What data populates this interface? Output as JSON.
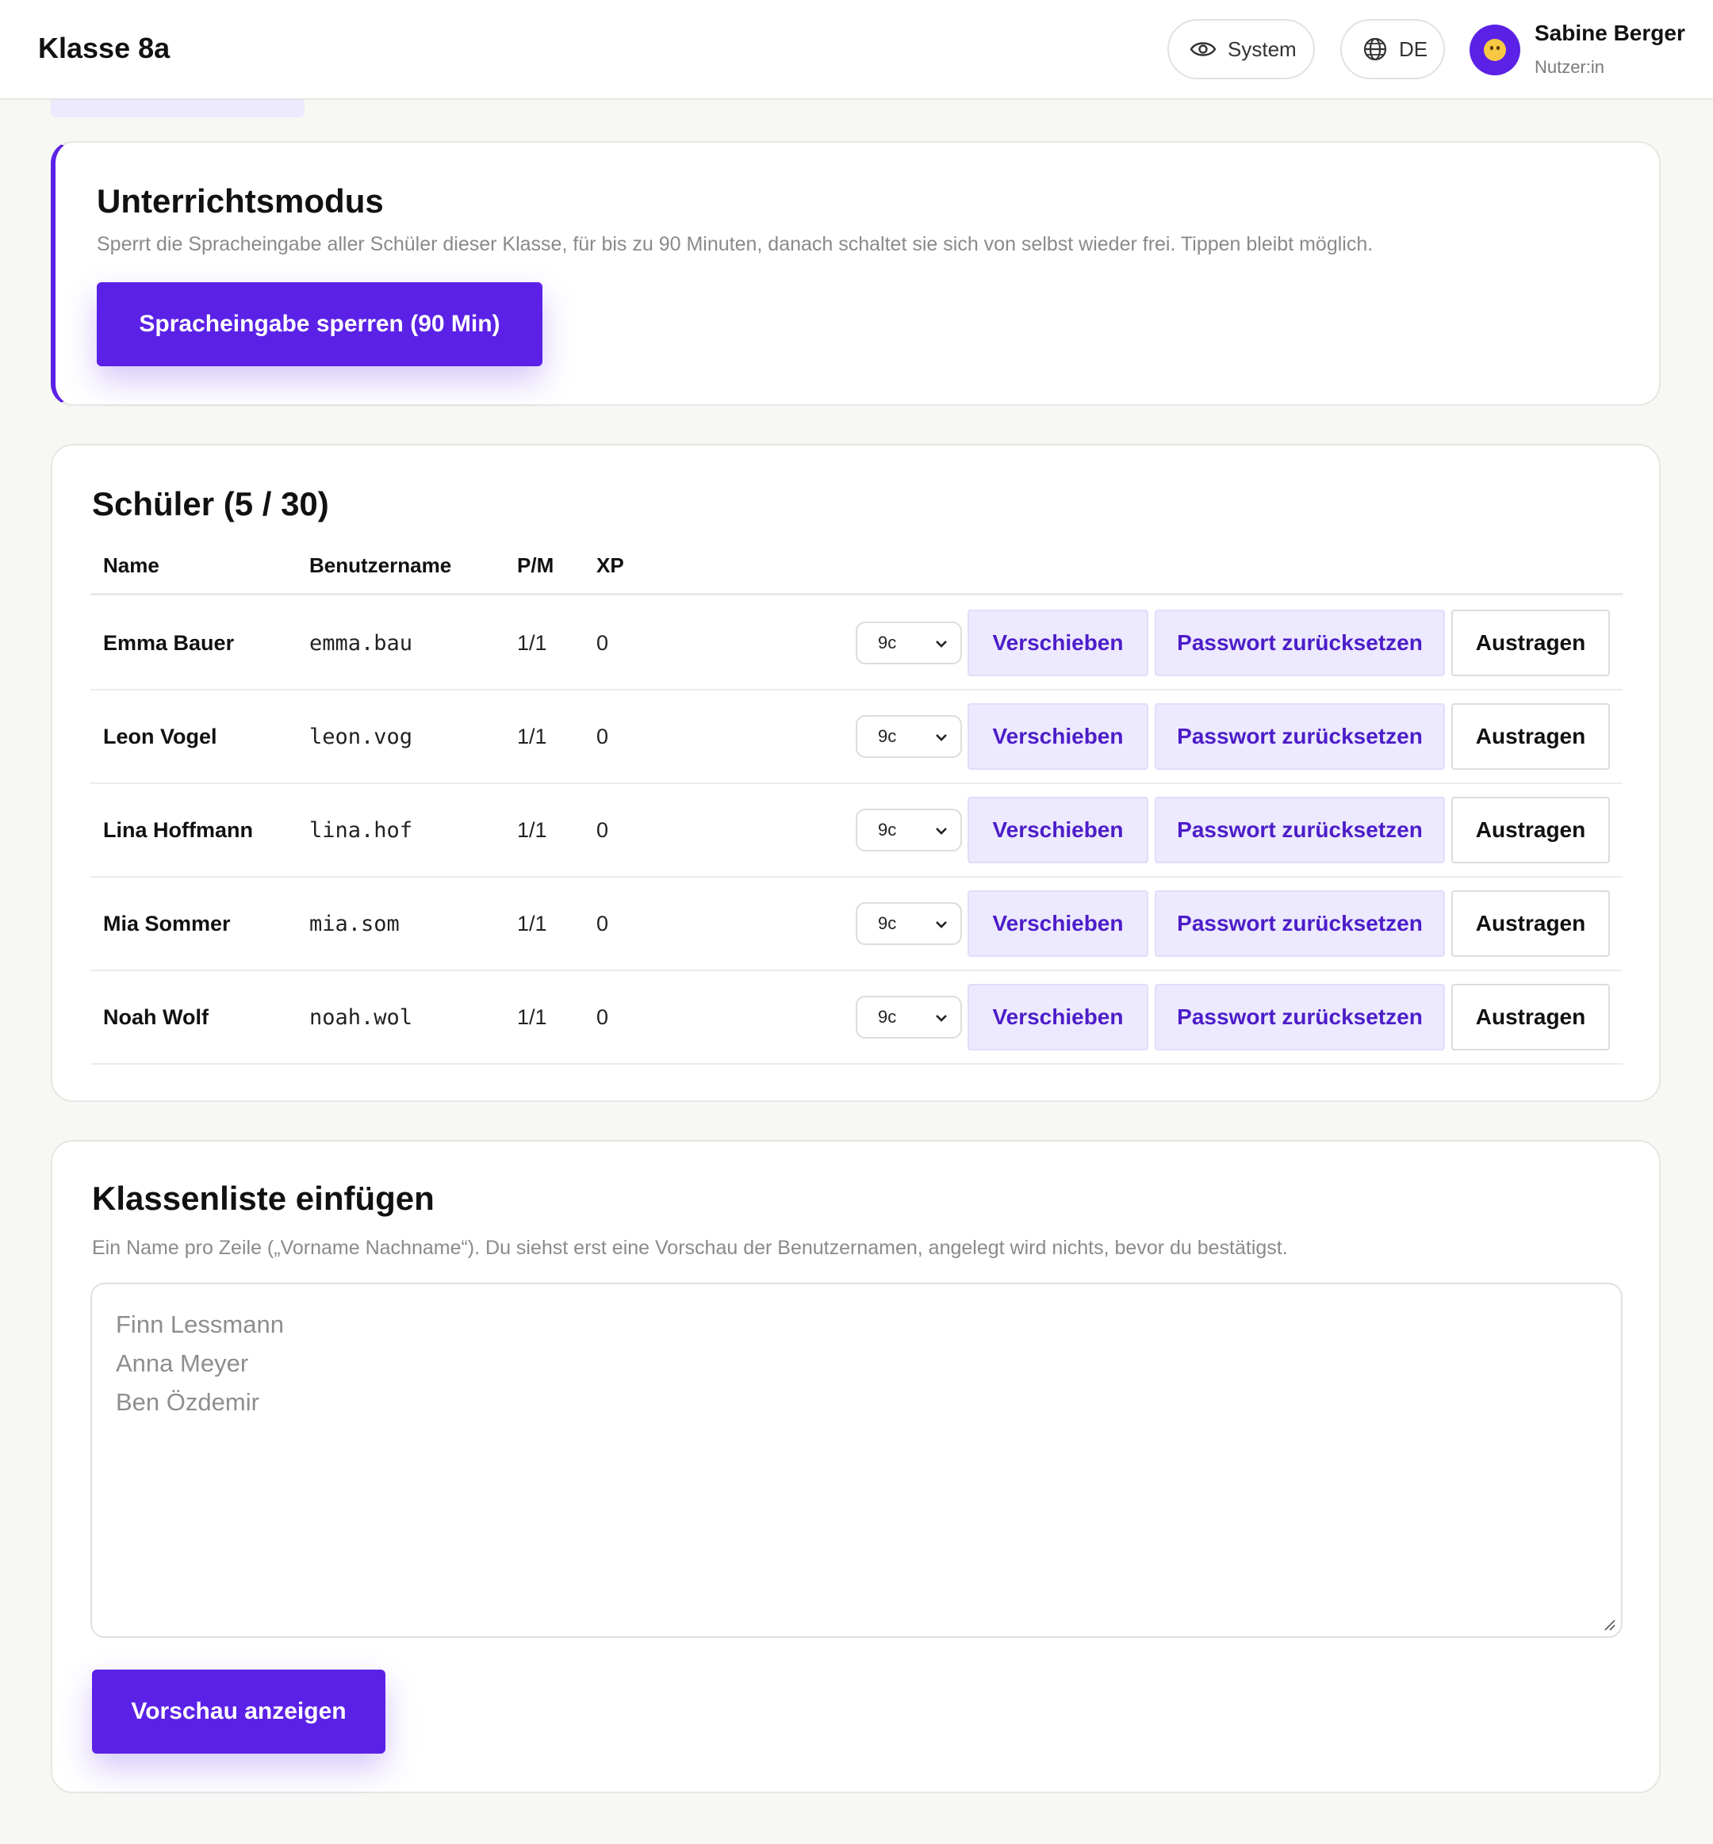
{
  "header": {
    "title": "Klasse 8a",
    "theme_label": "System",
    "theme_icon": "eye-icon",
    "language_label": "DE",
    "language_icon": "globe-icon",
    "user_name": "Sabine Berger",
    "user_role": "Nutzer:in",
    "avatar_icon": "smiley-icon"
  },
  "lock_card": {
    "title": "Unterrichtsmodus",
    "description": "Sperrt die Spracheingabe aller Schüler dieser Klasse, für bis zu 90 Minuten, danach schaltet sie sich von selbst wieder frei. Tippen bleibt möglich.",
    "button_label": "Spracheingabe sperren (90 Min)"
  },
  "students_card": {
    "title": "Schüler (5 / 30)",
    "columns": [
      "Name",
      "Benutzername",
      "P/M",
      "XP"
    ],
    "move_label": "Verschieben",
    "reset_label": "Passwort zurücksetzen",
    "remove_label": "Austragen",
    "rows": [
      {
        "name": "Emma Bauer",
        "username": "emma.bau",
        "pm": "1/1",
        "xp": "0",
        "target_class": "9c"
      },
      {
        "name": "Leon Vogel",
        "username": "leon.vog",
        "pm": "1/1",
        "xp": "0",
        "target_class": "9c"
      },
      {
        "name": "Lina Hoffmann",
        "username": "lina.hof",
        "pm": "1/1",
        "xp": "0",
        "target_class": "9c"
      },
      {
        "name": "Mia Sommer",
        "username": "mia.som",
        "pm": "1/1",
        "xp": "0",
        "target_class": "9c"
      },
      {
        "name": "Noah Wolf",
        "username": "noah.wol",
        "pm": "1/1",
        "xp": "0",
        "target_class": "9c"
      }
    ]
  },
  "import_card": {
    "title": "Klassenliste einfügen",
    "description": "Ein Name pro Zeile („Vorname Nachname“). Du siehst erst eine Vorschau der Benutzernamen, angelegt wird nichts, bevor du bestätigst.",
    "placeholder_lines": [
      "Finn Lessmann",
      "Anna Meyer",
      "Ben Özdemir"
    ],
    "button_label": "Vorschau anzeigen"
  },
  "colors": {
    "accent": "#5b21e6",
    "accent_soft": "#ede9fe",
    "accent_text": "#4c1dc9"
  }
}
